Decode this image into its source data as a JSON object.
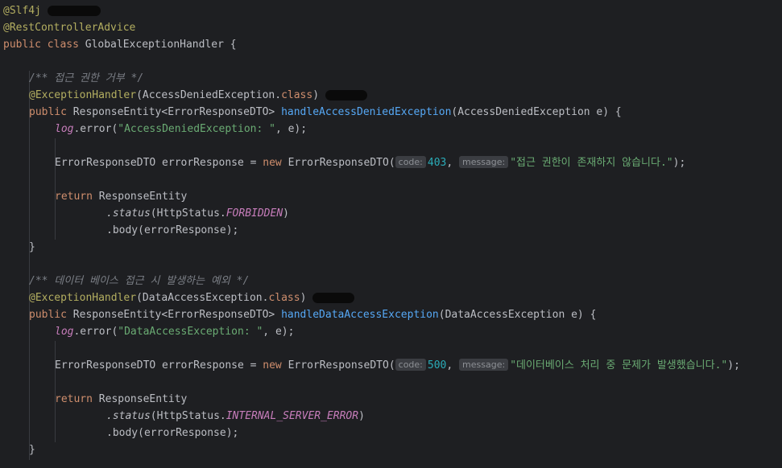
{
  "code": {
    "class_ann1": "@Slf4j",
    "class_ann2": "@RestControllerAdvice",
    "class_decl_kw": "public class ",
    "class_name": "GlobalExceptionHandler {",
    "m1": {
      "comment": "/** 접근 권한 거부 */",
      "ann": "@ExceptionHandler",
      "ann_arg": "(AccessDeniedException.",
      "ann_class_kw": "class",
      "ann_close": ")",
      "sig_kw": "public ",
      "sig_type": "ResponseEntity<ErrorResponseDTO> ",
      "sig_name": "handleAccessDeniedException",
      "sig_params": "(AccessDeniedException e) {",
      "log_var": "log",
      "log_call": ".error(",
      "log_str": "\"AccessDeniedException: \"",
      "log_rest": ", e);",
      "decl_lhs": "ErrorResponseDTO errorResponse = ",
      "decl_new": "new ",
      "decl_ctor": "ErrorResponseDTO(",
      "hint_code": "code:",
      "code_val": "403",
      "comma": ", ",
      "hint_message": "message:",
      "msg_str": "\"접근 권한이 존재하지 않습니다.\"",
      "decl_end": ");",
      "ret_kw": "return ",
      "ret_type": "ResponseEntity",
      "status_call": ".status",
      "status_open": "(HttpStatus.",
      "status_field": "FORBIDDEN",
      "status_close": ")",
      "body_call": ".body(errorResponse);",
      "close": "}"
    },
    "m2": {
      "comment": "/** 데이터 베이스 접근 시 발생하는 예외 */",
      "ann": "@ExceptionHandler",
      "ann_arg": "(DataAccessException.",
      "ann_class_kw": "class",
      "ann_close": ")",
      "sig_kw": "public ",
      "sig_type": "ResponseEntity<ErrorResponseDTO> ",
      "sig_name": "handleDataAccessException",
      "sig_params": "(DataAccessException e) {",
      "log_var": "log",
      "log_call": ".error(",
      "log_str": "\"DataAccessException: \"",
      "log_rest": ", e);",
      "decl_lhs": "ErrorResponseDTO errorResponse = ",
      "decl_new": "new ",
      "decl_ctor": "ErrorResponseDTO(",
      "hint_code": "code:",
      "code_val": "500",
      "comma": ", ",
      "hint_message": "message:",
      "msg_str": "\"데이터베이스 처리 중 문제가 발생했습니다.\"",
      "decl_end": ");",
      "ret_kw": "return ",
      "ret_type": "ResponseEntity",
      "status_call": ".status",
      "status_open": "(HttpStatus.",
      "status_field": "INTERNAL_SERVER_ERROR",
      "status_close": ")",
      "body_call": ".body(errorResponse);",
      "close": "}"
    }
  },
  "colors": {
    "background": "#1e1f22",
    "annotation": "#b3ae60",
    "keyword": "#cf8e6d",
    "method": "#56a8f5",
    "string": "#6aab73",
    "number": "#2aacb8",
    "comment": "#7a7e85",
    "field": "#c77dbb"
  }
}
